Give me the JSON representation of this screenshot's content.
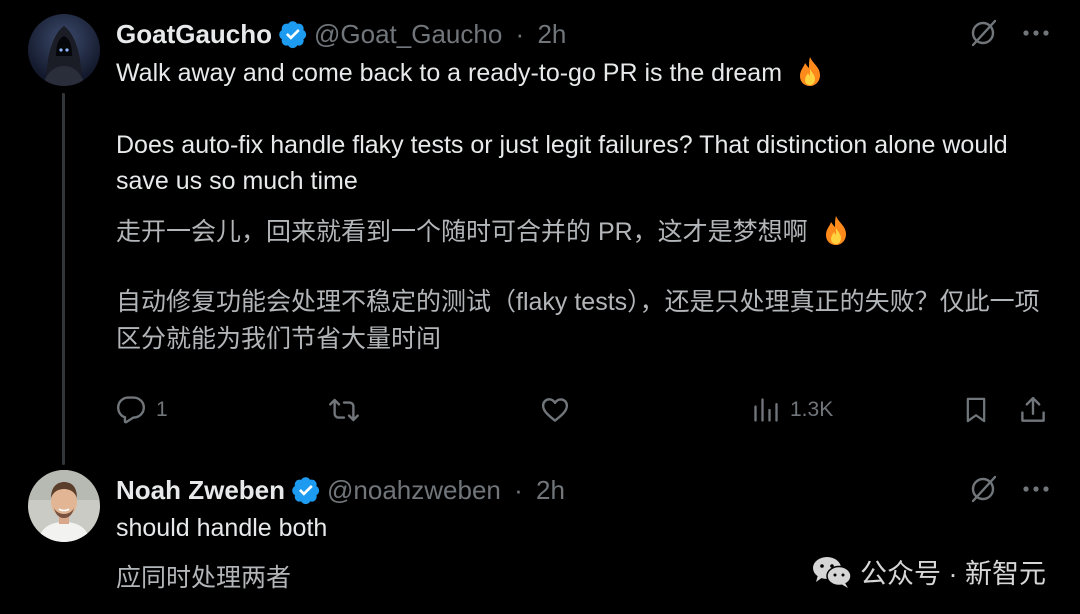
{
  "colors": {
    "background": "#000000",
    "text": "#e7e9ea",
    "muted": "#71767b",
    "verified": "#1d9bf0",
    "flame": "#ff8a1c"
  },
  "tweet1": {
    "name": "GoatGaucho",
    "handle": "@Goat_Gaucho",
    "time": "2h",
    "text_line1": "Walk away and come back to a ready-to-go PR is the dream",
    "text_para2": "Does auto-fix handle flaky tests or just legit failures? That distinction alone would save us so much time",
    "trans_line1": "走开一会儿，回来就看到一个随时可合并的 PR，这才是梦想啊",
    "trans_para2": "自动修复功能会处理不稳定的测试（flaky tests），还是只处理真正的失败？仅此一项区分就能为我们节省大量时间",
    "emoji": "fire-emoji",
    "actions": {
      "replies": "1",
      "retweets": "",
      "likes": "",
      "views": "1.3K"
    },
    "icons": [
      "grok-icon",
      "more-icon",
      "reply-icon",
      "retweet-icon",
      "like-icon",
      "views-icon",
      "bookmark-icon",
      "share-icon"
    ]
  },
  "tweet2": {
    "name": "Noah Zweben",
    "handle": "@noahzweben",
    "time": "2h",
    "text": "should handle both",
    "trans": "应同时处理两者"
  },
  "separator": "·",
  "watermark": {
    "label": "公众号 · 新智元",
    "icon": "wechat-icon"
  }
}
